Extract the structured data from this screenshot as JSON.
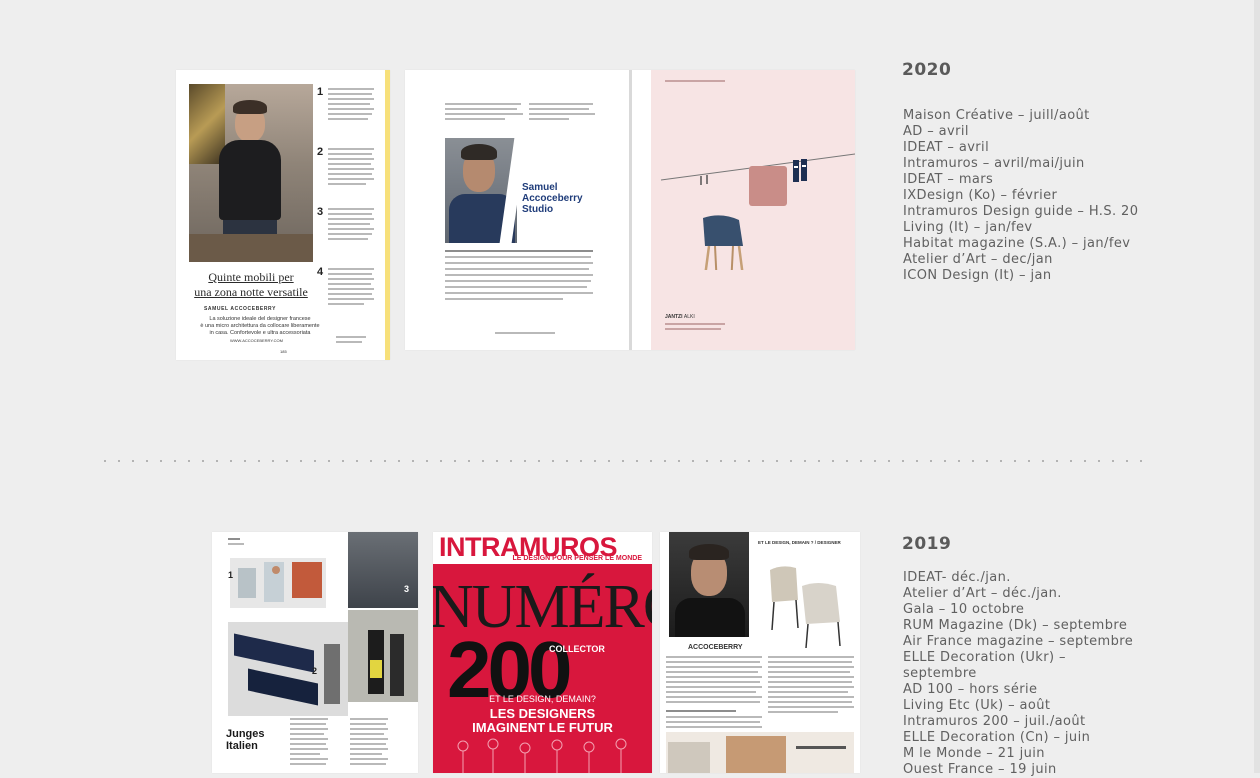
{
  "sections": [
    {
      "year": "2020",
      "items": [
        "Maison Créative – juill/août",
        "AD – avril",
        "IDEAT – avril",
        "Intramuros – avril/mai/juin",
        "IDEAT – mars",
        "IXDesign (Ko) – février",
        "Intramuros Design guide – H.S. 20",
        "Living (It) – jan/fev",
        "Habitat magazine (S.A.) – jan/fev",
        "Atelier d’Art – dec/jan",
        "ICON Design (It) – jan"
      ],
      "thumbs": {
        "italian": {
          "headline1": "Quinte mobili per",
          "headline2": "una zona notte versatile",
          "byline": "SAMUEL ACCOCEBERRY",
          "caption": "La soluzione ideale del designer francese\nè una micro architettura da collocare liberamente\nin casa. Confortevole e ultra accessoriata",
          "site": "WWW.ACCOCEBERRY.COM",
          "page": "185",
          "numbers": [
            "1",
            "2",
            "3",
            "4"
          ]
        },
        "korean": {
          "studio": "Samuel\nAccoceberry\nStudio",
          "product": "JANTZI",
          "product_sub": "ALKI"
        }
      }
    },
    {
      "year": "2019",
      "items": [
        "IDEAT- déc./jan.",
        "Atelier d’Art – déc./jan.",
        "Gala – 10 octobre",
        "RUM Magazine (Dk) – septembre",
        "Air France magazine – septembre",
        "ELLE Decoration (Ukr) –\nseptembre",
        "AD 100 – hors série",
        "Living Etc (Uk) – août",
        "Intramuros 200 – juil./août",
        "ELLE Decoration (Cn) – juin",
        "M le Monde – 21 juin",
        "Ouest France – 19 juin"
      ],
      "thumbs": {
        "german": {
          "title1": "Junges",
          "title2": "Italien",
          "numbers": [
            "1",
            "2",
            "3"
          ]
        },
        "intramuros": {
          "brand": "INTRAMUROS",
          "tagline": "LE DESIGN POUR PENSER LE MONDE",
          "numero": "NUMÉRO",
          "number": "200",
          "collector": "COLLECTOR",
          "question": "ET LE DESIGN, DEMAIN?",
          "line1": "LES DESIGNERS",
          "line2": "IMAGINENT LE FUTUR"
        },
        "portrait": {
          "name": "ACCOCEBERRY",
          "header": "ET LE DESIGN, DEMAIN ? / DESIGNER"
        }
      }
    }
  ],
  "colors": {
    "background": "#eeeeee",
    "text": "#606060",
    "intramuros_red": "#d8173d",
    "accent_yellow": "#f7e07a"
  }
}
